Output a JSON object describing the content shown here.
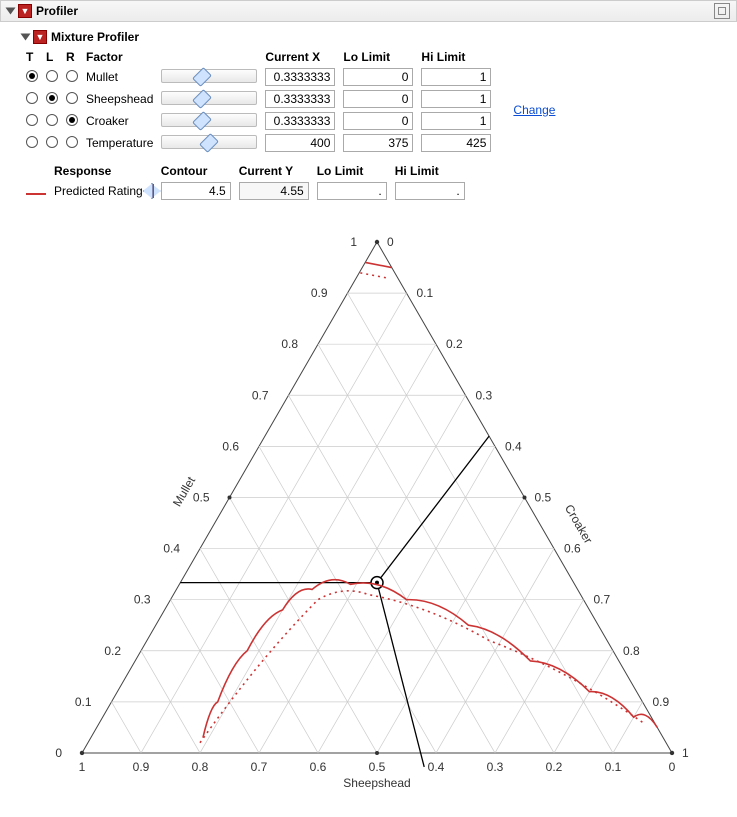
{
  "outer_panel_title": "Profiler",
  "inner_panel_title": "Mixture Profiler",
  "table_headers": {
    "t": "T",
    "l": "L",
    "r": "R",
    "factor": "Factor",
    "cx": "Current X",
    "lo": "Lo Limit",
    "hi": "Hi Limit"
  },
  "change_link": "Change",
  "factors": [
    {
      "name": "Mullet",
      "t": true,
      "l": false,
      "r": false,
      "cx": "0.3333333",
      "lo": "0",
      "hi": "1",
      "slider_pos": 0.42
    },
    {
      "name": "Sheepshead",
      "t": false,
      "l": true,
      "r": false,
      "cx": "0.3333333",
      "lo": "0",
      "hi": "1",
      "slider_pos": 0.42
    },
    {
      "name": "Croaker",
      "t": false,
      "l": false,
      "r": true,
      "cx": "0.3333333",
      "lo": "0",
      "hi": "1",
      "slider_pos": 0.42
    },
    {
      "name": "Temperature",
      "t": false,
      "l": false,
      "r": false,
      "cx": "400",
      "lo": "375",
      "hi": "425",
      "slider_pos": 0.5
    }
  ],
  "response_headers": {
    "resp": "Response",
    "contour": "Contour",
    "cy": "Current Y",
    "lo": "Lo Limit",
    "hi": "Hi Limit"
  },
  "response": {
    "name": "Predicted Rating",
    "contour": "4.5",
    "cy": "4.55",
    "lo": ".",
    "hi": "."
  },
  "chart_data": {
    "type": "ternary",
    "axes": {
      "left": {
        "label": "Mullet",
        "ticks": [
          0,
          0.1,
          0.2,
          0.3,
          0.4,
          0.5,
          0.6,
          0.7,
          0.8,
          0.9,
          1
        ]
      },
      "right": {
        "label": "Croaker",
        "ticks": [
          0,
          0.1,
          0.2,
          0.3,
          0.4,
          0.5,
          0.6,
          0.7,
          0.8,
          0.9,
          1
        ]
      },
      "bottom": {
        "label": "Sheepshead",
        "ticks": [
          0,
          0.1,
          0.2,
          0.3,
          0.4,
          0.5,
          0.6,
          0.7,
          0.8,
          0.9,
          1
        ]
      }
    },
    "current_point": {
      "mullet": 0.3333,
      "sheepshead": 0.3333,
      "croaker": 0.3333
    },
    "crosshair_rays_to": [
      "left_edge_at_mullet_0.333",
      "bottom_edge_at_sheepshead_0.5",
      "apex_direction_partway"
    ],
    "contours": [
      {
        "name": "Predicted Rating = 4.5 (solid)",
        "style": "solid",
        "color": "#c33",
        "comment": "Approximate barycentric (Mullet, Sheepshead, Croaker) samples along the visible red solid contour, read from gridlines.",
        "points_barycentric": [
          [
            0.95,
            0.0,
            0.05
          ],
          [
            0.96,
            0.04,
            0.0
          ],
          [
            0.03,
            0.78,
            0.19
          ],
          [
            0.1,
            0.72,
            0.18
          ],
          [
            0.2,
            0.62,
            0.18
          ],
          [
            0.28,
            0.52,
            0.2
          ],
          [
            0.32,
            0.45,
            0.23
          ],
          [
            0.33,
            0.38,
            0.29
          ],
          [
            0.3,
            0.3,
            0.4
          ],
          [
            0.25,
            0.22,
            0.53
          ],
          [
            0.18,
            0.15,
            0.67
          ],
          [
            0.12,
            0.08,
            0.8
          ],
          [
            0.07,
            0.03,
            0.9
          ],
          [
            0.05,
            0.0,
            0.95
          ]
        ]
      },
      {
        "name": "Predicted Rating dotted companion",
        "style": "dotted",
        "color": "#c33",
        "comment": "Dotted red curve tracking just below the solid one.",
        "points_barycentric": [
          [
            0.93,
            0.02,
            0.05
          ],
          [
            0.02,
            0.79,
            0.19
          ],
          [
            0.3,
            0.45,
            0.25
          ],
          [
            0.31,
            0.36,
            0.33
          ],
          [
            0.22,
            0.2,
            0.58
          ],
          [
            0.06,
            0.02,
            0.92
          ]
        ]
      }
    ]
  }
}
